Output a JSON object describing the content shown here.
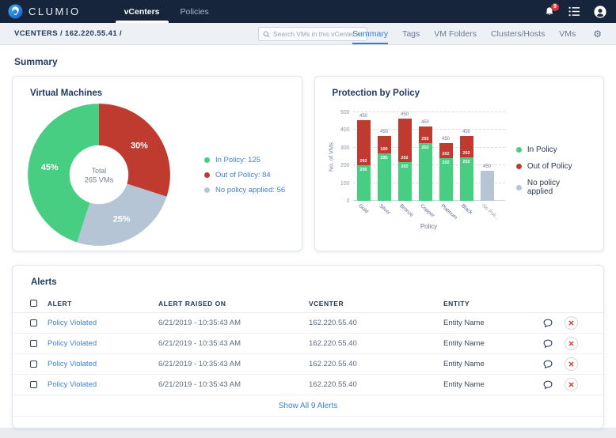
{
  "colors": {
    "navbar": "#16253C",
    "accent_blue": "#3F82D2",
    "green": "#47CE83",
    "red": "#BF3A2F",
    "gray_blue": "#B6C5D6",
    "badge_red": "#D7373F"
  },
  "navbar": {
    "brand": "CLUMIO",
    "tabs": [
      {
        "label": "vCenters",
        "active": true
      },
      {
        "label": "Policies",
        "active": false
      }
    ],
    "notifications_count": "9"
  },
  "breadcrumb": {
    "text": "VCENTERS / 162.220.55.41 /"
  },
  "search": {
    "placeholder": "Search VMs in this vCenter",
    "enter_glyph": "↵"
  },
  "view_tabs": [
    "Summary",
    "Tags",
    "VM Folders",
    "Clusters/Hosts",
    "VMs"
  ],
  "gear_glyph": "⚙",
  "page": {
    "section_title": "Summary"
  },
  "chart_data": [
    {
      "type": "pie",
      "title": "Virtual Machines",
      "donut": true,
      "center": {
        "label": "Total",
        "value": "265 VMs"
      },
      "slices": [
        {
          "name": "Out of Policy",
          "count": 84,
          "pct": 30,
          "label": "30%",
          "color": "#BF3A2F"
        },
        {
          "name": "No policy applied",
          "count": 56,
          "pct": 25,
          "label": "25%",
          "color": "#B6C5D6"
        },
        {
          "name": "In Policy",
          "count": 125,
          "pct": 45,
          "label": "45%",
          "color": "#47CE83"
        }
      ],
      "legend": [
        {
          "label": "In Policy: 125",
          "color": "#47CE83"
        },
        {
          "label": "Out of Policy: 84",
          "color": "#BF3A2F"
        },
        {
          "label": "No policy applied: 56",
          "color": "#B6C5D6"
        }
      ],
      "legend_position": "right"
    },
    {
      "type": "bar",
      "stacked": true,
      "title": "Protection by Policy",
      "xlabel": "Policy",
      "ylabel": "No. of VMs",
      "ylim": [
        0,
        500
      ],
      "yticks": [
        0,
        100,
        200,
        300,
        400,
        500
      ],
      "grid": "dashed",
      "categories": [
        "Gold",
        "Silver",
        "Bronze",
        "Copper",
        "Platinum",
        "Black",
        "No Poli..."
      ],
      "series": [
        {
          "name": "In Policy",
          "color": "#47CE83",
          "values": [
            200,
            270,
            220,
            325,
            240,
            245,
            0
          ],
          "value_labels": [
            "200",
            "295",
            "202",
            "202",
            "202",
            "202",
            ""
          ]
        },
        {
          "name": "Out of Policy",
          "color": "#BF3A2F",
          "values": [
            255,
            95,
            245,
            95,
            85,
            120,
            0
          ],
          "value_labels": [
            "292",
            "100",
            "202",
            "292",
            "202",
            "202",
            ""
          ]
        },
        {
          "name": "No policy applied",
          "color": "#B6C5D6",
          "values": [
            0,
            0,
            0,
            0,
            0,
            0,
            170
          ],
          "value_labels": [
            "",
            "",
            "",
            "",
            "",
            "",
            ""
          ]
        }
      ],
      "bar_top_labels": [
        "450",
        "450",
        "450",
        "450",
        "450",
        "450",
        "450"
      ],
      "legend": [
        {
          "label": "In Policy",
          "color": "#47CE83"
        },
        {
          "label": "Out of Policy",
          "color": "#BF3A2F"
        },
        {
          "label": "No policy applied",
          "color": "#B6C5D6"
        }
      ],
      "legend_position": "right"
    }
  ],
  "alerts": {
    "title": "Alerts",
    "columns": [
      "ALERT",
      "ALERT RAISED ON",
      "VCENTER",
      "ENTITY"
    ],
    "rows": [
      {
        "alert": "Policy Violated",
        "raised_on": "6/21/2019 - 10:35:43 AM",
        "vcenter": "162.220.55.40",
        "entity": "Entity Name"
      },
      {
        "alert": "Policy Violated",
        "raised_on": "6/21/2019 - 10:35:43 AM",
        "vcenter": "162.220.55.40",
        "entity": "Entity Name"
      },
      {
        "alert": "Policy Violated",
        "raised_on": "6/21/2019 - 10:35:43 AM",
        "vcenter": "162.220.55.40",
        "entity": "Entity Name"
      },
      {
        "alert": "Policy Violated",
        "raised_on": "6/21/2019 - 10:35:43 AM",
        "vcenter": "162.220.55.40",
        "entity": "Entity Name"
      }
    ],
    "show_all": "Show All 9 Alerts"
  }
}
